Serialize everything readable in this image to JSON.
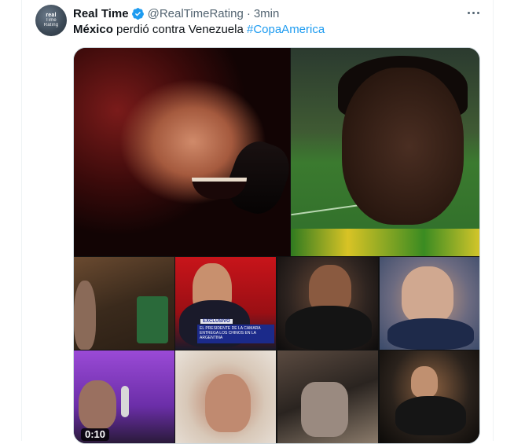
{
  "author": {
    "name": "Real Time",
    "handle": "@RealTimeRating",
    "separator": "·",
    "time": "3min",
    "avatar_text": [
      "real",
      "Time",
      "Rating"
    ]
  },
  "tweet": {
    "text_bold": "México",
    "text_plain": " perdió contra Venezuela ",
    "hashtag": "#CopaAmerica"
  },
  "media": {
    "duration": "0:10",
    "banner_tag": "EXCLUSIVO",
    "banner_text": "EL PRESIDENTE DE LA CAMARA ENTREGA LOS CHINOS EN LA ARGENTINA"
  },
  "icons": {
    "verified": "verified-badge-icon",
    "more": "more-options-icon"
  },
  "colors": {
    "link": "#1d9bf0",
    "verified": "#1d9bf0",
    "muted": "#536471",
    "text": "#0f1419"
  }
}
